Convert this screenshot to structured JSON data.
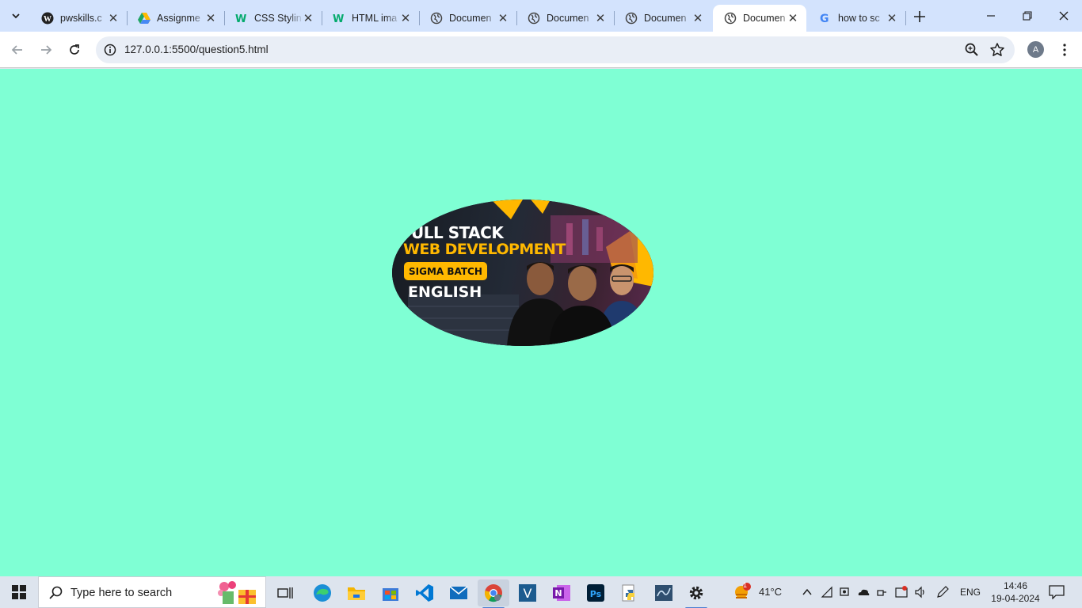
{
  "browser": {
    "tabs": [
      {
        "title": "pwskills.c",
        "favicon": "wordpress-icon",
        "active": false
      },
      {
        "title": "Assignme",
        "favicon": "google-drive-icon",
        "active": false
      },
      {
        "title": "CSS Stylin",
        "favicon": "w3schools-icon",
        "active": false
      },
      {
        "title": "HTML ima",
        "favicon": "w3schools-icon",
        "active": false
      },
      {
        "title": "Documen",
        "favicon": "globe-icon",
        "active": false
      },
      {
        "title": "Documen",
        "favicon": "globe-icon",
        "active": false
      },
      {
        "title": "Documen",
        "favicon": "globe-icon",
        "active": false
      },
      {
        "title": "Documen",
        "favicon": "globe-icon",
        "active": true
      },
      {
        "title": "how to sc",
        "favicon": "google-icon",
        "active": false
      }
    ],
    "address": "127.0.0.1:5500/question5.html",
    "profile_initial": "A"
  },
  "page": {
    "background": "#7fffd4",
    "banner": {
      "line1": "ULL STACK",
      "line2": "WEB DEVELOPMENT",
      "badge": "SIGMA BATCH",
      "line3": "ENGLISH"
    }
  },
  "taskbar": {
    "search_placeholder": "Type here to search",
    "apps": [
      "task-view-icon",
      "edge-icon",
      "file-explorer-icon",
      "store-icon",
      "vscode-icon",
      "mail-icon",
      "chrome-icon",
      "v-app-icon",
      "onenote-icon",
      "photoshop-icon",
      "python-icon",
      "sql-icon",
      "settings-icon"
    ],
    "weather": {
      "temp": "41°C",
      "alert_count": "1"
    },
    "language": "ENG",
    "time": "14:46",
    "date": "19-04-2024"
  }
}
